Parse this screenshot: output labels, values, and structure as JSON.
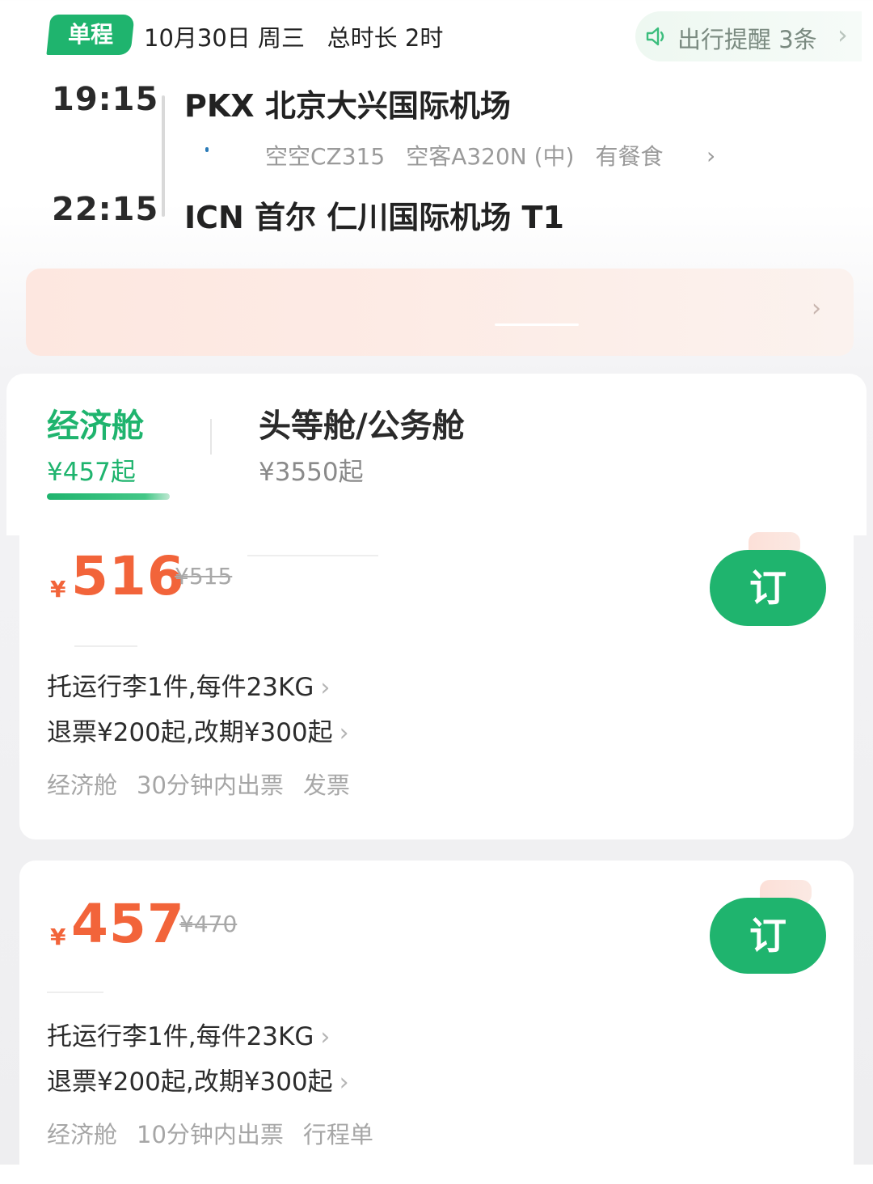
{
  "header": {
    "trip_type": "单程",
    "date_duration": "10月30日 周三   总时长 2时",
    "reminder_text": "出行提醒 3条",
    "reminder_icon": "speaker-icon"
  },
  "flight": {
    "departure_time": "19:15",
    "departure_airport": "PKX 北京大兴国际机场",
    "arrival_time": "22:15",
    "arrival_airport": "ICN 首尔 仁川国际机场 T1",
    "flight_number": "空空CZ315",
    "aircraft": "空客A320N (中)",
    "meal": "有餐食"
  },
  "cabin_tabs": [
    {
      "name": "经济舱",
      "price": "¥457起"
    },
    {
      "name": "头等舱/公务舱",
      "price": "¥3550起"
    }
  ],
  "fares": [
    {
      "currency": "¥",
      "price": "516",
      "original_price": "¥515",
      "baggage": "托运行李1件,每件23KG",
      "refund": "退票¥200起,改期¥300起",
      "tags": [
        "经济舱",
        "30分钟内出票",
        "发票"
      ],
      "book_label": "订"
    },
    {
      "currency": "¥",
      "price": "457",
      "original_price": "¥470",
      "baggage": "托运行李1件,每件23KG",
      "refund": "退票¥200起,改期¥300起",
      "tags": [
        "经济舱",
        "10分钟内出票",
        "行程单"
      ],
      "book_label": "订"
    }
  ],
  "colors": {
    "brand_green": "#1fb46e",
    "price_orange": "#f2643a",
    "promo_bg": "#fde7e0"
  }
}
